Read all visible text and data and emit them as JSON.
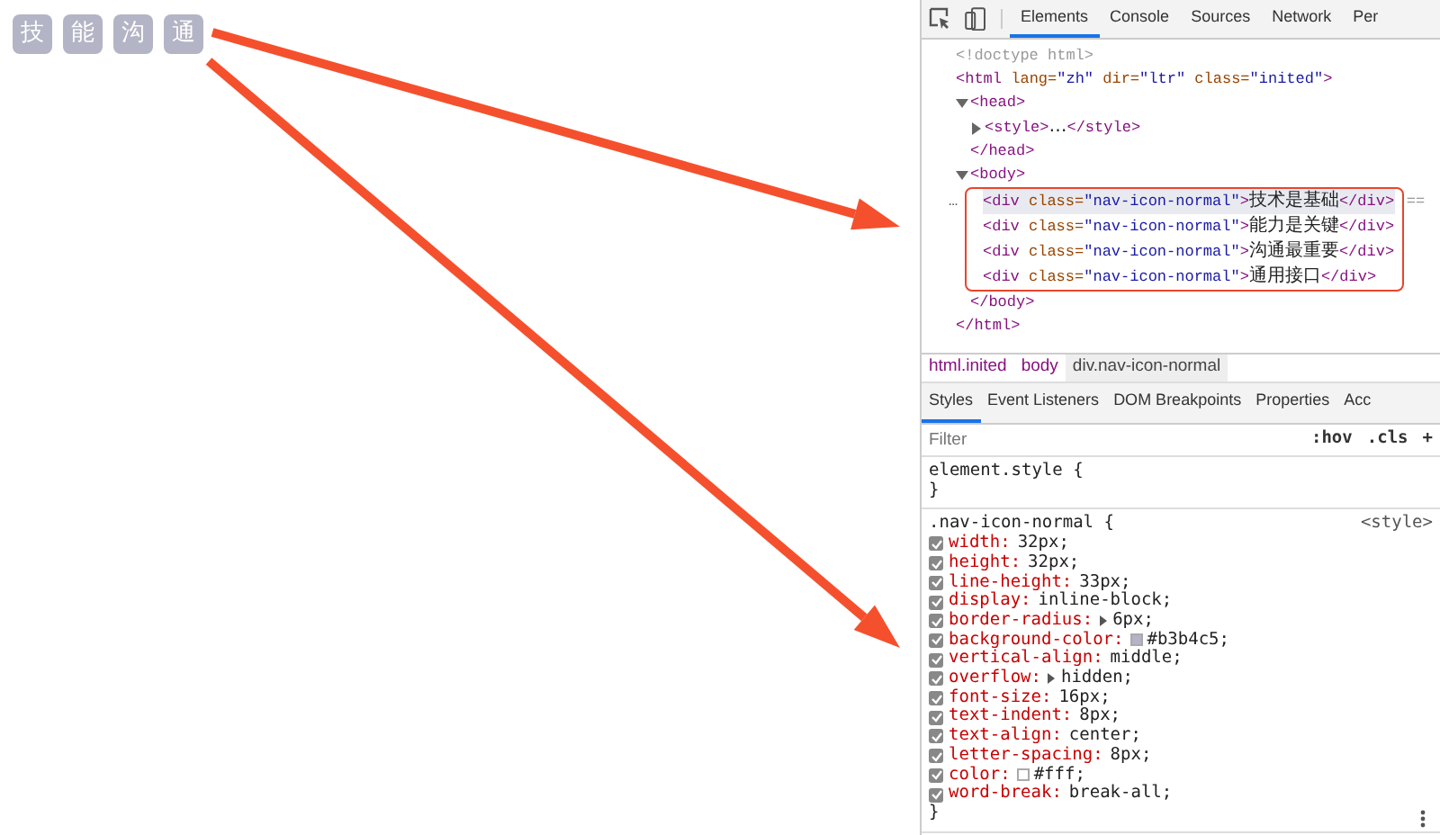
{
  "page_tiles": [
    {
      "text": "技"
    },
    {
      "text": "能"
    },
    {
      "text": "沟"
    },
    {
      "text": "通"
    }
  ],
  "devtools": {
    "panel_tabs": [
      {
        "label": "Elements",
        "selected": true
      },
      {
        "label": "Console",
        "selected": false
      },
      {
        "label": "Sources",
        "selected": false
      },
      {
        "label": "Network",
        "selected": false
      },
      {
        "label": "Per",
        "selected": false
      }
    ],
    "dom_tree": [
      {
        "text": "<!doctype html>"
      },
      {
        "text": "<html lang=\"zh\" dir=\"ltr\" class=\"inited\">",
        "children": [
          {
            "text": "<head>",
            "expanded": true,
            "closing": "</head>",
            "children": [
              {
                "text": "<style>…</style>",
                "expanded": false
              }
            ]
          },
          {
            "text": "<body>",
            "expanded": true,
            "closing": "</body>",
            "boxed": true,
            "children": [
              {
                "text": "<div class=\"nav-icon-normal\">技术是基础</div>",
                "selected": true,
                "gutter": "…",
                "suffix": "=="
              },
              {
                "text": "<div class=\"nav-icon-normal\">能力是关键</div>",
                "selected": false
              },
              {
                "text": "<div class=\"nav-icon-normal\">沟通最重要</div>",
                "selected": false
              },
              {
                "text": "<div class=\"nav-icon-normal\">通用接口</div>",
                "selected": false
              }
            ]
          }
        ]
      },
      {
        "text": "</html>"
      }
    ],
    "breadcrumbs": [
      {
        "label": "html.inited",
        "selected": false
      },
      {
        "label": "body",
        "selected": false
      },
      {
        "label": "div.nav-icon-normal",
        "selected": true
      }
    ],
    "sidebar_tabs": [
      {
        "label": "Styles",
        "selected": true
      },
      {
        "label": "Event Listeners",
        "selected": false
      },
      {
        "label": "DOM Breakpoints",
        "selected": false
      },
      {
        "label": "Properties",
        "selected": false
      },
      {
        "label": "Acc",
        "selected": false
      }
    ],
    "filter": {
      "placeholder": "Filter",
      "hov": ":hov",
      "cls": ".cls",
      "add": "+"
    },
    "rules": [
      {
        "selector": "element.style {",
        "close": "}"
      },
      {
        "selector": ".nav-icon-normal {",
        "source": "<style>",
        "close": "}",
        "declarations": [
          {
            "name": "width:",
            "value": "32px;",
            "checked": true
          },
          {
            "name": "height:",
            "value": "32px;",
            "checked": true
          },
          {
            "name": "line-height:",
            "value": "33px;",
            "checked": true
          },
          {
            "name": "display:",
            "value": "inline-block;",
            "checked": true
          },
          {
            "name": "border-radius:",
            "value": "6px;",
            "checked": true,
            "expandable": true
          },
          {
            "name": "background-color:",
            "value": "#b3b4c5;",
            "checked": true,
            "color": "#b3b4c5"
          },
          {
            "name": "vertical-align:",
            "value": "middle;",
            "checked": true
          },
          {
            "name": "overflow:",
            "value": "hidden;",
            "checked": true,
            "expandable": true
          },
          {
            "name": "font-size:",
            "value": "16px;",
            "checked": true
          },
          {
            "name": "text-indent:",
            "value": "8px;",
            "checked": true
          },
          {
            "name": "text-align:",
            "value": "center;",
            "checked": true
          },
          {
            "name": "letter-spacing:",
            "value": "8px;",
            "checked": true
          },
          {
            "name": "color:",
            "value": "#fff;",
            "checked": true,
            "color": "#ffffff"
          },
          {
            "name": "word-break:",
            "value": "break-all;",
            "checked": true
          }
        ]
      }
    ]
  }
}
